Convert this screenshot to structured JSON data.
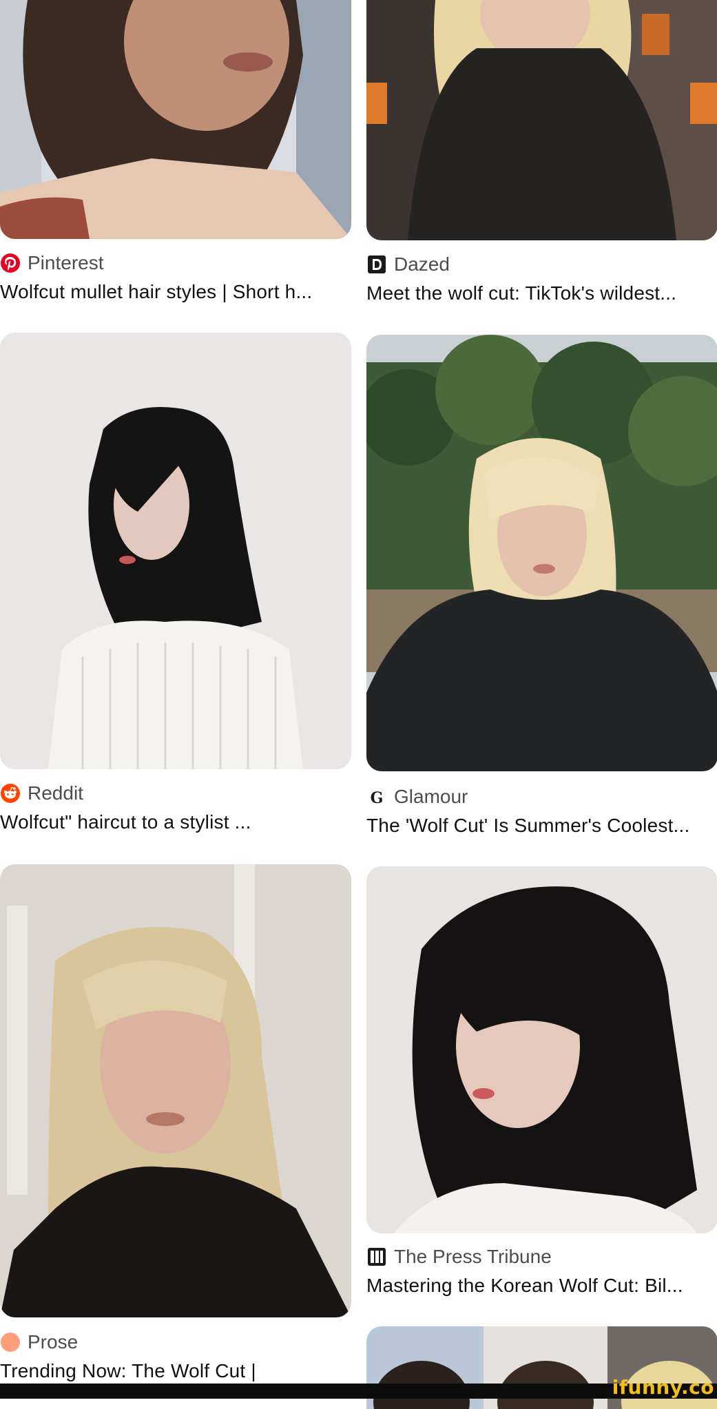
{
  "results": {
    "left": [
      {
        "source": "Pinterest",
        "source_icon": "pinterest-icon",
        "title": "Wolfcut mullet hair styles | Short h..."
      },
      {
        "source": "Reddit",
        "source_icon": "reddit-icon",
        "title": "Wolfcut\" haircut to a stylist ..."
      },
      {
        "source": "Prose",
        "source_icon": "prose-icon",
        "title": "Trending Now: The Wolf Cut |"
      }
    ],
    "right": [
      {
        "source": "Dazed",
        "source_icon": "dazed-icon",
        "title": "Meet the wolf cut: TikTok's wildest..."
      },
      {
        "source": "Glamour",
        "source_icon": "glamour-icon",
        "title": "The 'Wolf Cut' Is Summer's Coolest..."
      },
      {
        "source": "The Press Tribune",
        "source_icon": "press-tribune-icon",
        "title": "Mastering the Korean Wolf Cut: Bil..."
      }
    ]
  },
  "watermark": "ifunny.co",
  "colors": {
    "pinterest": "#e60023",
    "reddit": "#ff4500",
    "prose": "#ff9e7a",
    "watermark": "#f2c012"
  }
}
